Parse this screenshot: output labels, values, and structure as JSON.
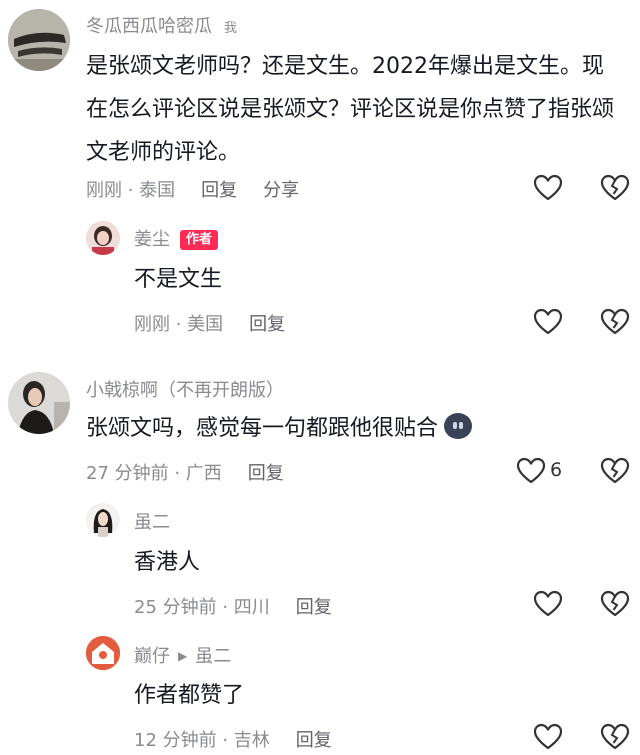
{
  "comments": [
    {
      "username": "冬瓜西瓜哈密瓜",
      "badge": "我",
      "text": "是张颂文老师吗？还是文生。2022年爆出是文生。现在怎么评论区说是张颂文？评论区说是你点赞了指张颂文老师的评论。",
      "time": "刚刚 · 泰国",
      "reply_label": "回复",
      "share_label": "分享",
      "like_count": "",
      "replies": [
        {
          "username": "姜尘",
          "tag": "作者",
          "text": "不是文生",
          "time": "刚刚 · 美国",
          "reply_label": "回复"
        }
      ]
    },
    {
      "username": "小戟椋啊（不再开朗版）",
      "text": "张颂文吗，感觉每一句都跟他很贴合",
      "time": "27 分钟前 · 广西",
      "reply_label": "回复",
      "like_count": "6",
      "replies": [
        {
          "username": "虽二",
          "text": "香港人",
          "time": "25 分钟前 · 四川",
          "reply_label": "回复"
        },
        {
          "username": "巅仔",
          "reply_to": "虽二",
          "text": "作者都赞了",
          "time": "12 分钟前 · 吉林",
          "reply_label": "回复"
        }
      ]
    }
  ],
  "icons": {
    "like": "heart-outline-icon",
    "dislike": "broken-heart-icon",
    "reply_arrow": "play-triangle-icon"
  },
  "colors": {
    "author_tag": "#fe2c55",
    "meta_text": "#8a8b91",
    "body_text": "#161823"
  }
}
